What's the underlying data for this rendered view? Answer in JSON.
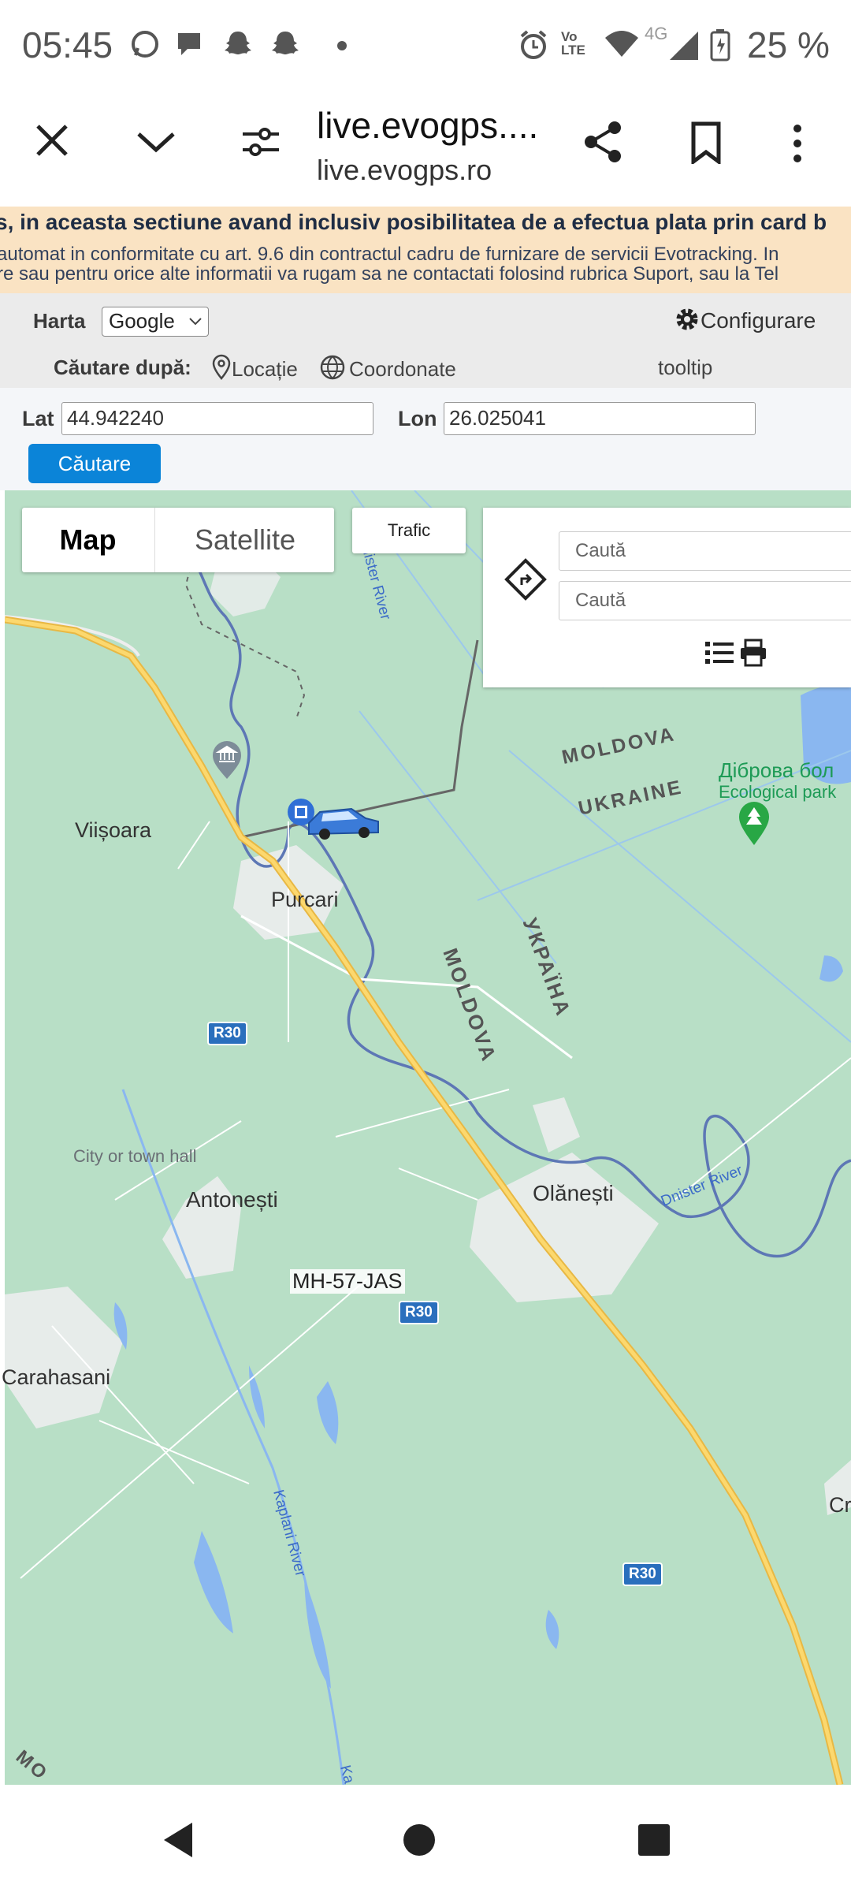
{
  "status_bar": {
    "time": "05:45",
    "battery_percent": "25 %",
    "network": "4G",
    "volte": "Vo LTE",
    "icons": [
      "whatsapp-icon",
      "chat-icon",
      "snapchat-icon",
      "snapchat-icon",
      "dot-icon",
      "alarm-icon",
      "volte-icon",
      "wifi-icon",
      "signal-icon",
      "battery-icon"
    ]
  },
  "browser": {
    "title": "live.evogps....",
    "host": "live.evogps.ro",
    "icons": [
      "close-icon",
      "chevron-down-icon",
      "site-settings-icon",
      "share-icon",
      "bookmark-icon",
      "more-icon"
    ]
  },
  "notice": {
    "line1": "s, in aceasta sectiune avand inclusiv posibilitatea de a efectua plata prin card b",
    "line2": "automat in conformitate cu art. 9.6 din contractul cadru de furnizare de servicii Evotracking. In",
    "line3": "re sau pentru orice alte informatii va rugam sa ne contactati folosind rubrica Suport, sau la Tel"
  },
  "controls": {
    "map_label": "Harta",
    "map_provider": "Google",
    "config_label": "Configurare",
    "search_by_label": "Căutare după:",
    "option_location": "Locație",
    "option_coordinates": "Coordonate",
    "tooltip": "tooltip",
    "lat_label": "Lat",
    "lat_value": "44.942240",
    "lon_label": "Lon",
    "lon_value": "26.025041",
    "search_button": "Căutare"
  },
  "map": {
    "type_map": "Map",
    "type_satellite": "Satellite",
    "traffic": "Trafic",
    "route_placeholder_1": "Caută",
    "route_placeholder_2": "Caută",
    "labels": {
      "dnister_river_top": "Dnister River",
      "moldova_border": "MOLDOVA",
      "ukraine_border": "UKRAINE",
      "park_name": "Діброва бол",
      "park_type": "Ecological park",
      "viisoara": "Viișoara",
      "purcari": "Purcari",
      "moldova_vertical": "MOLDOVA",
      "ukraina_vertical": "УКРАЇНА",
      "r30_a": "R30",
      "city_hall": "City or town hall",
      "antonesti": "Antonești",
      "olanesti": "Olănești",
      "dnister_river_bottom": "Dnister River",
      "vehicle_plate": "MH-57-JAS",
      "r30_b": "R30",
      "carahasani": "Carahasani",
      "kaplani_river": "Kaplani River",
      "r30_c": "R30",
      "cr_partial": "Cr",
      "mo_partial": "MO",
      "ka_partial": "Ka"
    }
  },
  "colors": {
    "notice_bg": "#fae3c3",
    "map_bg": "#b8dfc6",
    "road": "#f2c94c",
    "water": "#8ab7f0",
    "button": "#0b84d8"
  }
}
